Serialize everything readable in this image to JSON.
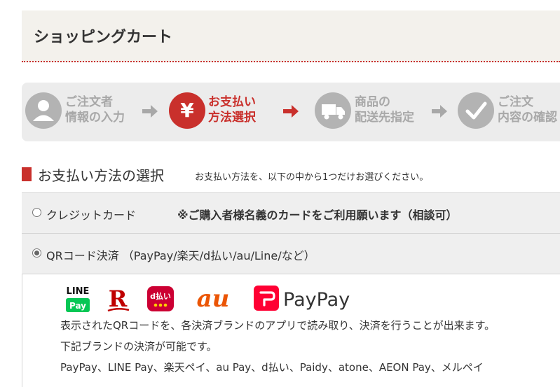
{
  "header": {
    "title": "ショッピングカート"
  },
  "steps": [
    {
      "line1": "ご注文者",
      "line2": "情報の入力",
      "icon": "person-icon",
      "active": false
    },
    {
      "line1": "お支払い",
      "line2": "方法選択",
      "icon": "yen-icon",
      "active": true
    },
    {
      "line1": "商品の",
      "line2": "配送先指定",
      "icon": "truck-icon",
      "active": false
    },
    {
      "line1": "ご注文",
      "line2": "内容の確認",
      "icon": "check-icon",
      "active": false
    }
  ],
  "section": {
    "title": "お支払い方法の選択",
    "note": "お支払い方法を、以下の中から1つだけお選びください。"
  },
  "payment_options": [
    {
      "label": "クレジットカード",
      "note": "※ご購入者様名義のカードをご利用願います（相談可）",
      "selected": false
    },
    {
      "label": "QRコード決済 （PayPay/楽天/d払い/au/Line/など）",
      "selected": true
    }
  ],
  "qr_detail": {
    "logos": {
      "line_pay_top": "LINE",
      "line_pay_bottom": "Pay",
      "rakuten": "R",
      "d_barai": "d払い",
      "au": "au",
      "paypay": "PayPay"
    },
    "line1": "表示されたQRコードを、各決済ブランドのアプリで読み取り、決済を行うことが出来ます。",
    "line2": "下記ブランドの決済が可能です。",
    "line3": "PayPay、LINE Pay、楽天ペイ、au Pay、d払い、Paidy、atone、AEON Pay、メルペイ"
  },
  "colors": {
    "accent": "#c9302c",
    "inactive_step": "#a8a8a8",
    "line_green": "#06c755",
    "paypay_red": "#ff0033",
    "au_orange": "#eb5505"
  }
}
